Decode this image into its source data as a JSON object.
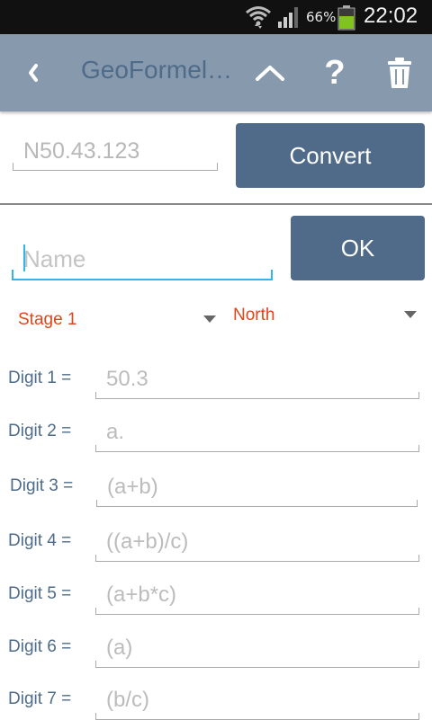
{
  "status_bar": {
    "battery_percent": "66%",
    "time": "22:02",
    "icons": [
      "wifi-icon",
      "signal-icon",
      "battery-icon"
    ],
    "battery_color": "#7fc31c"
  },
  "action_bar": {
    "title": "GeoFormelRechner",
    "icons": [
      "back-chevron-icon",
      "chevron-up-icon",
      "help-icon",
      "trash-icon"
    ],
    "help_glyph": "?",
    "background_color": "#8799ac"
  },
  "converter": {
    "coordinate_placeholder": "N50.43.123",
    "convert_label": "Convert"
  },
  "name_form": {
    "name_placeholder": "Name",
    "ok_label": "OK"
  },
  "spinners": {
    "stage": "Stage 1",
    "direction": "North"
  },
  "digits": [
    {
      "label": "Digit 1 =",
      "placeholder": "50.3"
    },
    {
      "label": "Digit 2 =",
      "placeholder": "a."
    },
    {
      "label": "Digit 3 =",
      "placeholder": "(a+b)"
    },
    {
      "label": "Digit 4 =",
      "placeholder": "((a+b)/c)"
    },
    {
      "label": "Digit 5 =",
      "placeholder": "(a+b*c)"
    },
    {
      "label": "Digit 6 =",
      "placeholder": "(a)"
    },
    {
      "label": "Digit 7 =",
      "placeholder": "(b/c)"
    }
  ],
  "colors": {
    "primary_button": "#4f6b89",
    "accent_focus": "#33b5e5",
    "spinner_text": "#e0461a",
    "label_text": "#4e6b89"
  }
}
